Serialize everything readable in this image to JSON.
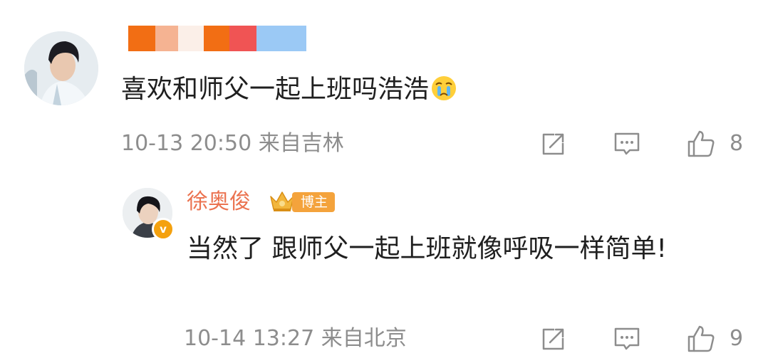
{
  "comment": {
    "username_redacted": true,
    "text": "喜欢和师父一起上班吗浩浩",
    "emoji": "crying-face-emoji",
    "time": "10-13 20:50",
    "location": "来自吉林",
    "like_count": "8"
  },
  "reply": {
    "username": "徐奥俊",
    "badge": "博主",
    "text": "当然了 跟师父一起上班就像呼吸一样简单!",
    "time": "10-14 13:27",
    "location": "来自北京",
    "like_count": "9"
  },
  "colors": {
    "username": "#eb7350",
    "meta": "#8d8d8d",
    "badge": "#f4a33c",
    "verified": "#f4a10f"
  },
  "icons": [
    "share-icon",
    "comment-icon",
    "like-icon",
    "crown-icon",
    "verified-icon"
  ]
}
